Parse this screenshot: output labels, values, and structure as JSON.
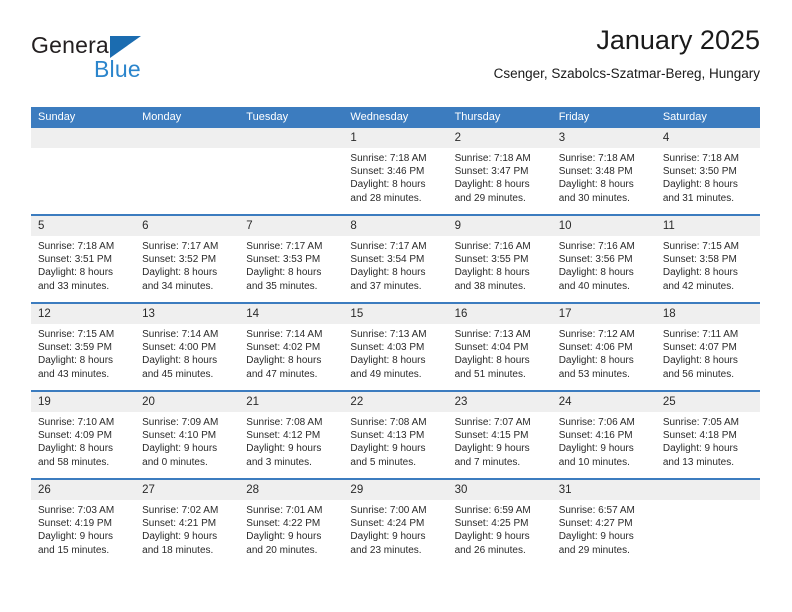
{
  "logo": {
    "word_one": "General",
    "word_two": "Blue",
    "triangle_color": "#1b6cb0",
    "blue_color": "#2b85cc"
  },
  "header": {
    "title": "January 2025",
    "subtitle": "Csenger, Szabolcs-Szatmar-Bereg, Hungary"
  },
  "calendar": {
    "header_bg": "#3c7cbf",
    "date_strip_bg": "#efefef",
    "weekdays": [
      "Sunday",
      "Monday",
      "Tuesday",
      "Wednesday",
      "Thursday",
      "Friday",
      "Saturday"
    ],
    "weeks": [
      [
        {
          "day": "",
          "lines": []
        },
        {
          "day": "",
          "lines": []
        },
        {
          "day": "",
          "lines": []
        },
        {
          "day": "1",
          "lines": [
            "Sunrise: 7:18 AM",
            "Sunset: 3:46 PM",
            "Daylight: 8 hours",
            "and 28 minutes."
          ]
        },
        {
          "day": "2",
          "lines": [
            "Sunrise: 7:18 AM",
            "Sunset: 3:47 PM",
            "Daylight: 8 hours",
            "and 29 minutes."
          ]
        },
        {
          "day": "3",
          "lines": [
            "Sunrise: 7:18 AM",
            "Sunset: 3:48 PM",
            "Daylight: 8 hours",
            "and 30 minutes."
          ]
        },
        {
          "day": "4",
          "lines": [
            "Sunrise: 7:18 AM",
            "Sunset: 3:50 PM",
            "Daylight: 8 hours",
            "and 31 minutes."
          ]
        }
      ],
      [
        {
          "day": "5",
          "lines": [
            "Sunrise: 7:18 AM",
            "Sunset: 3:51 PM",
            "Daylight: 8 hours",
            "and 33 minutes."
          ]
        },
        {
          "day": "6",
          "lines": [
            "Sunrise: 7:17 AM",
            "Sunset: 3:52 PM",
            "Daylight: 8 hours",
            "and 34 minutes."
          ]
        },
        {
          "day": "7",
          "lines": [
            "Sunrise: 7:17 AM",
            "Sunset: 3:53 PM",
            "Daylight: 8 hours",
            "and 35 minutes."
          ]
        },
        {
          "day": "8",
          "lines": [
            "Sunrise: 7:17 AM",
            "Sunset: 3:54 PM",
            "Daylight: 8 hours",
            "and 37 minutes."
          ]
        },
        {
          "day": "9",
          "lines": [
            "Sunrise: 7:16 AM",
            "Sunset: 3:55 PM",
            "Daylight: 8 hours",
            "and 38 minutes."
          ]
        },
        {
          "day": "10",
          "lines": [
            "Sunrise: 7:16 AM",
            "Sunset: 3:56 PM",
            "Daylight: 8 hours",
            "and 40 minutes."
          ]
        },
        {
          "day": "11",
          "lines": [
            "Sunrise: 7:15 AM",
            "Sunset: 3:58 PM",
            "Daylight: 8 hours",
            "and 42 minutes."
          ]
        }
      ],
      [
        {
          "day": "12",
          "lines": [
            "Sunrise: 7:15 AM",
            "Sunset: 3:59 PM",
            "Daylight: 8 hours",
            "and 43 minutes."
          ]
        },
        {
          "day": "13",
          "lines": [
            "Sunrise: 7:14 AM",
            "Sunset: 4:00 PM",
            "Daylight: 8 hours",
            "and 45 minutes."
          ]
        },
        {
          "day": "14",
          "lines": [
            "Sunrise: 7:14 AM",
            "Sunset: 4:02 PM",
            "Daylight: 8 hours",
            "and 47 minutes."
          ]
        },
        {
          "day": "15",
          "lines": [
            "Sunrise: 7:13 AM",
            "Sunset: 4:03 PM",
            "Daylight: 8 hours",
            "and 49 minutes."
          ]
        },
        {
          "day": "16",
          "lines": [
            "Sunrise: 7:13 AM",
            "Sunset: 4:04 PM",
            "Daylight: 8 hours",
            "and 51 minutes."
          ]
        },
        {
          "day": "17",
          "lines": [
            "Sunrise: 7:12 AM",
            "Sunset: 4:06 PM",
            "Daylight: 8 hours",
            "and 53 minutes."
          ]
        },
        {
          "day": "18",
          "lines": [
            "Sunrise: 7:11 AM",
            "Sunset: 4:07 PM",
            "Daylight: 8 hours",
            "and 56 minutes."
          ]
        }
      ],
      [
        {
          "day": "19",
          "lines": [
            "Sunrise: 7:10 AM",
            "Sunset: 4:09 PM",
            "Daylight: 8 hours",
            "and 58 minutes."
          ]
        },
        {
          "day": "20",
          "lines": [
            "Sunrise: 7:09 AM",
            "Sunset: 4:10 PM",
            "Daylight: 9 hours",
            "and 0 minutes."
          ]
        },
        {
          "day": "21",
          "lines": [
            "Sunrise: 7:08 AM",
            "Sunset: 4:12 PM",
            "Daylight: 9 hours",
            "and 3 minutes."
          ]
        },
        {
          "day": "22",
          "lines": [
            "Sunrise: 7:08 AM",
            "Sunset: 4:13 PM",
            "Daylight: 9 hours",
            "and 5 minutes."
          ]
        },
        {
          "day": "23",
          "lines": [
            "Sunrise: 7:07 AM",
            "Sunset: 4:15 PM",
            "Daylight: 9 hours",
            "and 7 minutes."
          ]
        },
        {
          "day": "24",
          "lines": [
            "Sunrise: 7:06 AM",
            "Sunset: 4:16 PM",
            "Daylight: 9 hours",
            "and 10 minutes."
          ]
        },
        {
          "day": "25",
          "lines": [
            "Sunrise: 7:05 AM",
            "Sunset: 4:18 PM",
            "Daylight: 9 hours",
            "and 13 minutes."
          ]
        }
      ],
      [
        {
          "day": "26",
          "lines": [
            "Sunrise: 7:03 AM",
            "Sunset: 4:19 PM",
            "Daylight: 9 hours",
            "and 15 minutes."
          ]
        },
        {
          "day": "27",
          "lines": [
            "Sunrise: 7:02 AM",
            "Sunset: 4:21 PM",
            "Daylight: 9 hours",
            "and 18 minutes."
          ]
        },
        {
          "day": "28",
          "lines": [
            "Sunrise: 7:01 AM",
            "Sunset: 4:22 PM",
            "Daylight: 9 hours",
            "and 20 minutes."
          ]
        },
        {
          "day": "29",
          "lines": [
            "Sunrise: 7:00 AM",
            "Sunset: 4:24 PM",
            "Daylight: 9 hours",
            "and 23 minutes."
          ]
        },
        {
          "day": "30",
          "lines": [
            "Sunrise: 6:59 AM",
            "Sunset: 4:25 PM",
            "Daylight: 9 hours",
            "and 26 minutes."
          ]
        },
        {
          "day": "31",
          "lines": [
            "Sunrise: 6:57 AM",
            "Sunset: 4:27 PM",
            "Daylight: 9 hours",
            "and 29 minutes."
          ]
        },
        {
          "day": "",
          "lines": []
        }
      ]
    ]
  }
}
